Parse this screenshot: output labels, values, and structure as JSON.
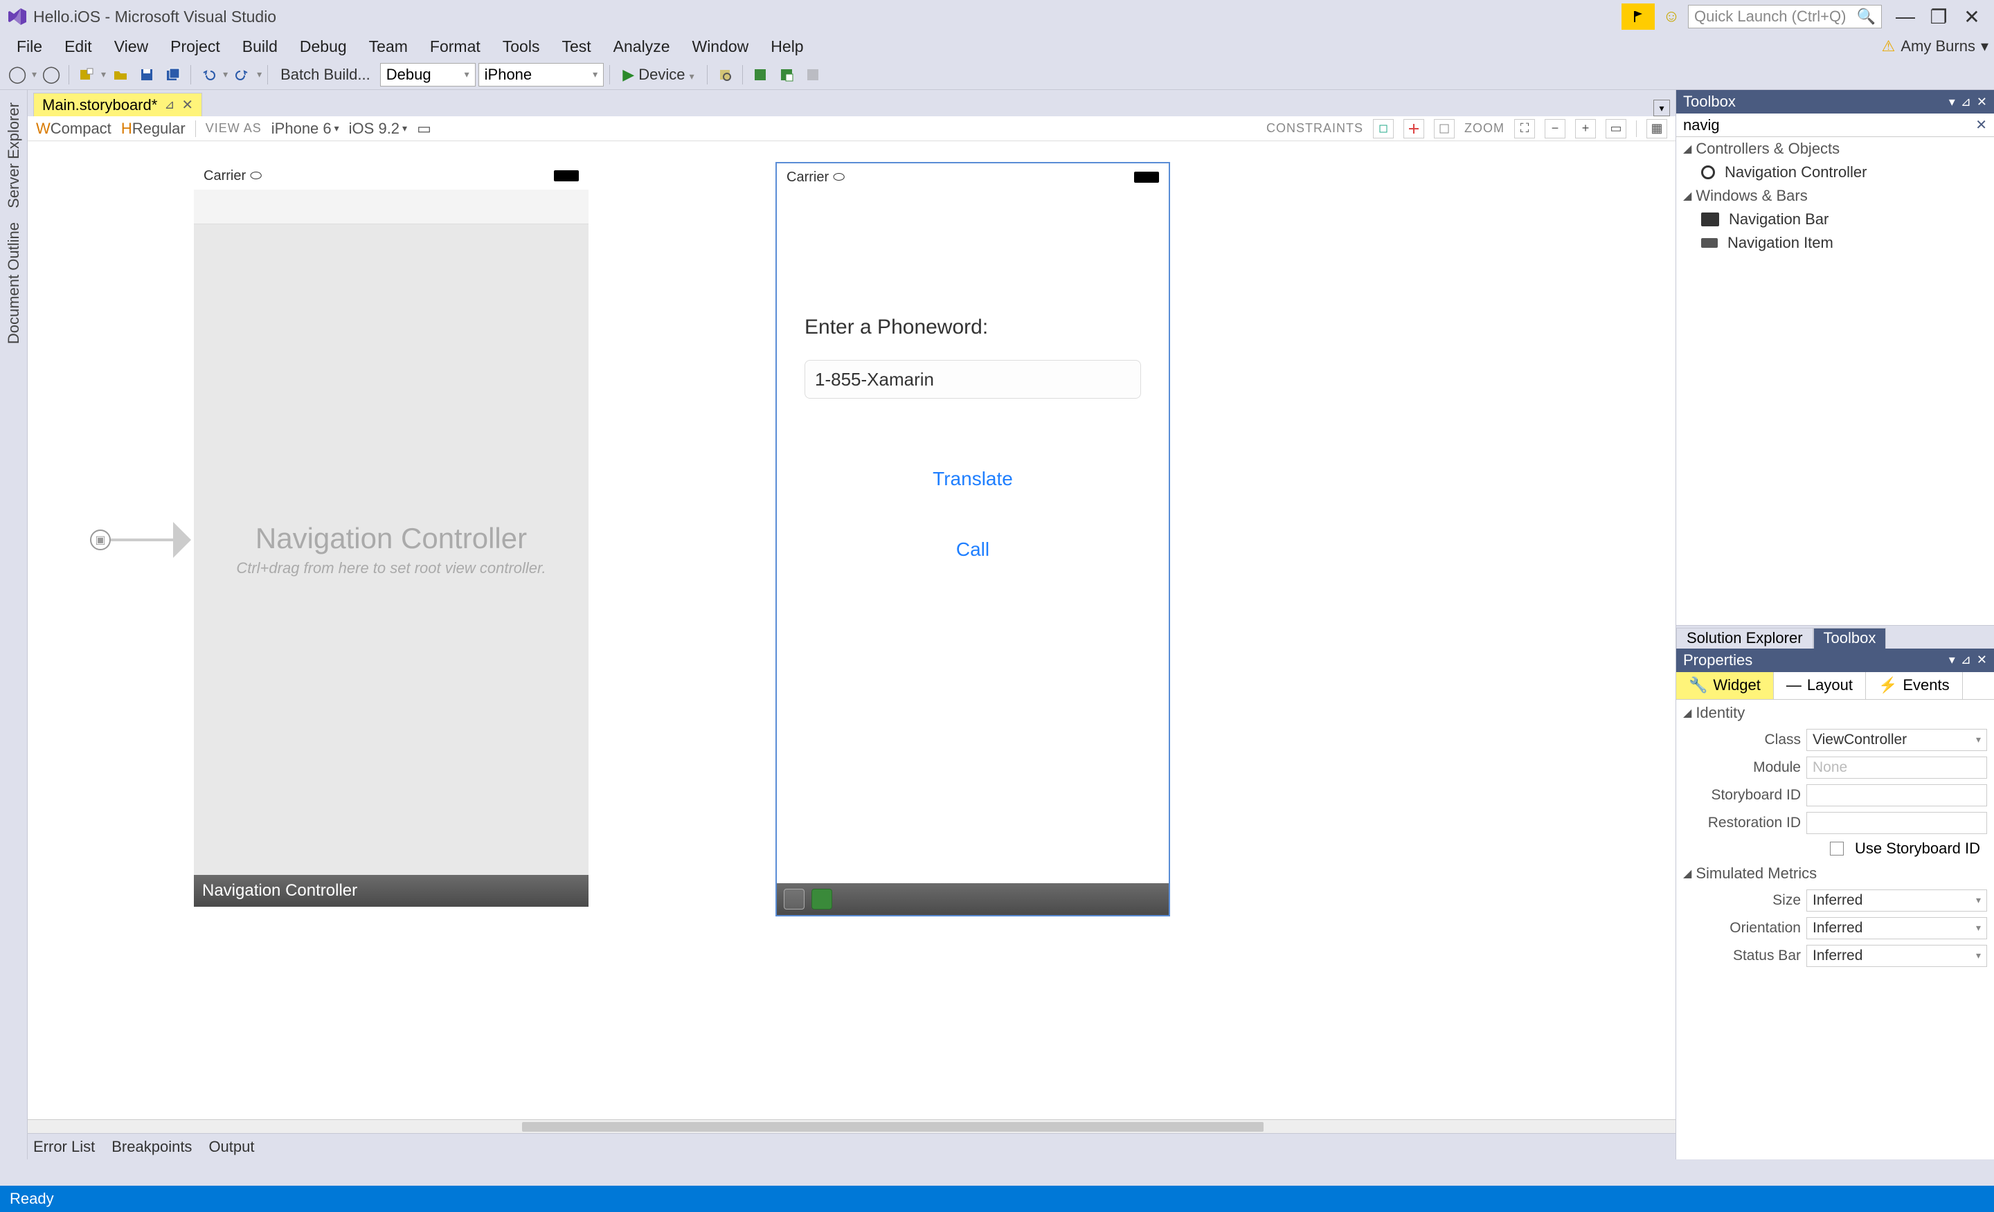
{
  "titlebar": {
    "title": "Hello.iOS - Microsoft Visual Studio",
    "quick_launch_placeholder": "Quick Launch (Ctrl+Q)"
  },
  "menubar": {
    "items": [
      "File",
      "Edit",
      "View",
      "Project",
      "Build",
      "Debug",
      "Team",
      "Format",
      "Tools",
      "Test",
      "Analyze",
      "Window",
      "Help"
    ],
    "user": "Amy Burns"
  },
  "toolbar": {
    "batch_build": "Batch Build...",
    "config": "Debug",
    "platform": "iPhone",
    "device": "Device"
  },
  "left_rail": {
    "tabs": [
      "Server Explorer",
      "Document Outline"
    ]
  },
  "doc_tab": {
    "name": "Main.storyboard*"
  },
  "designer_bar": {
    "size_class_w": "W",
    "size_class_w_val": "Compact",
    "size_class_h": "H",
    "size_class_h_val": "Regular",
    "view_as": "VIEW AS",
    "device": "iPhone 6",
    "ios": "iOS 9.2",
    "constraints": "CONSTRAINTS",
    "zoom": "ZOOM"
  },
  "scene1": {
    "carrier": "Carrier",
    "title": "Navigation Controller",
    "hint": "Ctrl+drag from here to set root view controller.",
    "label": "Navigation Controller"
  },
  "scene2": {
    "carrier": "Carrier",
    "label": "Enter a Phoneword:",
    "textfield": "1-855-Xamarin",
    "btn_translate": "Translate",
    "btn_call": "Call"
  },
  "toolbox": {
    "title": "Toolbox",
    "search": "navig",
    "cats": {
      "controllers": "Controllers & Objects",
      "windows": "Windows & Bars"
    },
    "items": {
      "nav_controller": "Navigation Controller",
      "nav_bar": "Navigation Bar",
      "nav_item": "Navigation Item"
    }
  },
  "panel_tabs": {
    "solution": "Solution Explorer",
    "toolbox": "Toolbox"
  },
  "properties": {
    "title": "Properties",
    "tabs": {
      "widget": "Widget",
      "layout": "Layout",
      "events": "Events"
    },
    "identity": "Identity",
    "class_label": "Class",
    "class_value": "ViewController",
    "module_label": "Module",
    "module_placeholder": "None",
    "storyboard_id": "Storyboard ID",
    "restoration_id": "Restoration ID",
    "use_storyboard_id": "Use Storyboard ID",
    "simulated": "Simulated Metrics",
    "size_label": "Size",
    "size_value": "Inferred",
    "orientation_label": "Orientation",
    "orientation_value": "Inferred",
    "statusbar_label": "Status Bar",
    "statusbar_value": "Inferred"
  },
  "bottom_tabs": [
    "Error List",
    "Breakpoints",
    "Output"
  ],
  "status": "Ready"
}
